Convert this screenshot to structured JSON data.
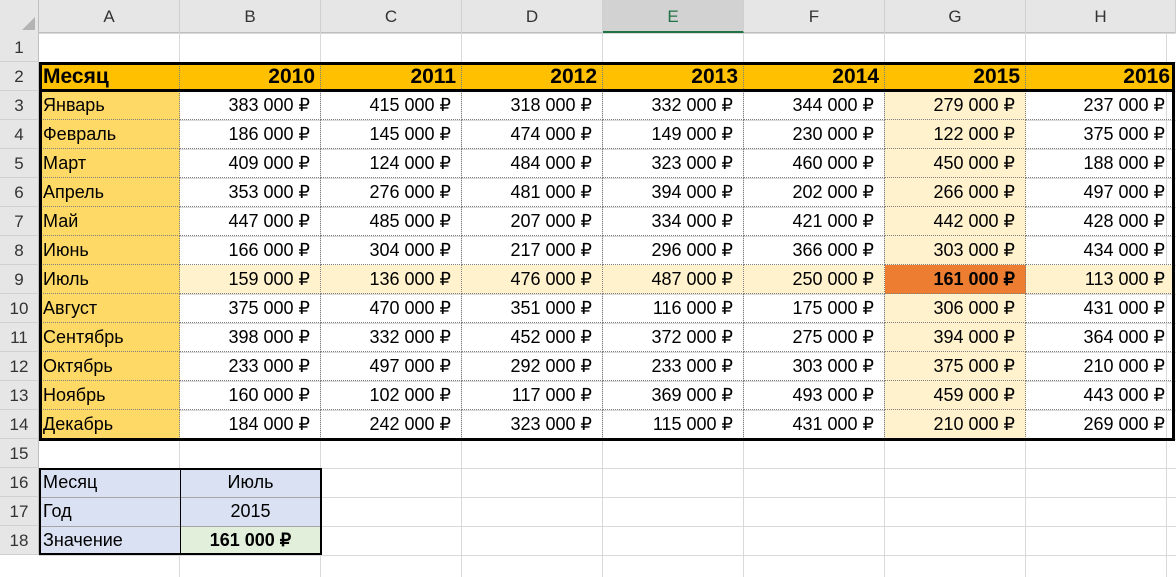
{
  "columns": [
    "A",
    "B",
    "C",
    "D",
    "E",
    "F",
    "G",
    "H"
  ],
  "selected_column": "E",
  "rows": [
    "1",
    "2",
    "3",
    "4",
    "5",
    "6",
    "7",
    "8",
    "9",
    "10",
    "11",
    "12",
    "13",
    "14",
    "15",
    "16",
    "17",
    "18"
  ],
  "table": {
    "header": [
      "Месяц",
      "2010",
      "2011",
      "2012",
      "2013",
      "2014",
      "2015",
      "2016"
    ],
    "body": [
      [
        "Январь",
        "383 000 ₽",
        "415 000 ₽",
        "318 000 ₽",
        "332 000 ₽",
        "344 000 ₽",
        "279 000 ₽",
        "237 000 ₽"
      ],
      [
        "Февраль",
        "186 000 ₽",
        "145 000 ₽",
        "474 000 ₽",
        "149 000 ₽",
        "230 000 ₽",
        "122 000 ₽",
        "375 000 ₽"
      ],
      [
        "Март",
        "409 000 ₽",
        "124 000 ₽",
        "484 000 ₽",
        "323 000 ₽",
        "460 000 ₽",
        "450 000 ₽",
        "188 000 ₽"
      ],
      [
        "Апрель",
        "353 000 ₽",
        "276 000 ₽",
        "481 000 ₽",
        "394 000 ₽",
        "202 000 ₽",
        "266 000 ₽",
        "497 000 ₽"
      ],
      [
        "Май",
        "447 000 ₽",
        "485 000 ₽",
        "207 000 ₽",
        "334 000 ₽",
        "421 000 ₽",
        "442 000 ₽",
        "428 000 ₽"
      ],
      [
        "Июнь",
        "166 000 ₽",
        "304 000 ₽",
        "217 000 ₽",
        "296 000 ₽",
        "366 000 ₽",
        "303 000 ₽",
        "434 000 ₽"
      ],
      [
        "Июль",
        "159 000 ₽",
        "136 000 ₽",
        "476 000 ₽",
        "487 000 ₽",
        "250 000 ₽",
        "161 000 ₽",
        "113 000 ₽"
      ],
      [
        "Август",
        "375 000 ₽",
        "470 000 ₽",
        "351 000 ₽",
        "116 000 ₽",
        "175 000 ₽",
        "306 000 ₽",
        "431 000 ₽"
      ],
      [
        "Сентябрь",
        "398 000 ₽",
        "332 000 ₽",
        "452 000 ₽",
        "372 000 ₽",
        "275 000 ₽",
        "394 000 ₽",
        "364 000 ₽"
      ],
      [
        "Октябрь",
        "233 000 ₽",
        "497 000 ₽",
        "292 000 ₽",
        "233 000 ₽",
        "303 000 ₽",
        "375 000 ₽",
        "210 000 ₽"
      ],
      [
        "Ноябрь",
        "160 000 ₽",
        "102 000 ₽",
        "117 000 ₽",
        "369 000 ₽",
        "493 000 ₽",
        "459 000 ₽",
        "443 000 ₽"
      ],
      [
        "Декабрь",
        "184 000 ₽",
        "242 000 ₽",
        "323 000 ₽",
        "115 000 ₽",
        "431 000 ₽",
        "210 000 ₽",
        "269 000 ₽"
      ]
    ],
    "highlight_row_label": "Июль",
    "highlight_col_label": "2015"
  },
  "lookup": {
    "month_label": "Месяц",
    "month_value": "Июль",
    "year_label": "Год",
    "year_value": "2015",
    "result_label": "Значение",
    "result_value": "161 000 ₽"
  },
  "colors": {
    "header_bg": "#ffc000",
    "month_col_bg": "#ffd966",
    "highlight_bg": "#fff2cc",
    "intersection_bg": "#ed7d31",
    "lookup_label_bg": "#d9e1f2",
    "lookup_result_bg": "#e2efda",
    "selected_col_accent": "#217346"
  }
}
